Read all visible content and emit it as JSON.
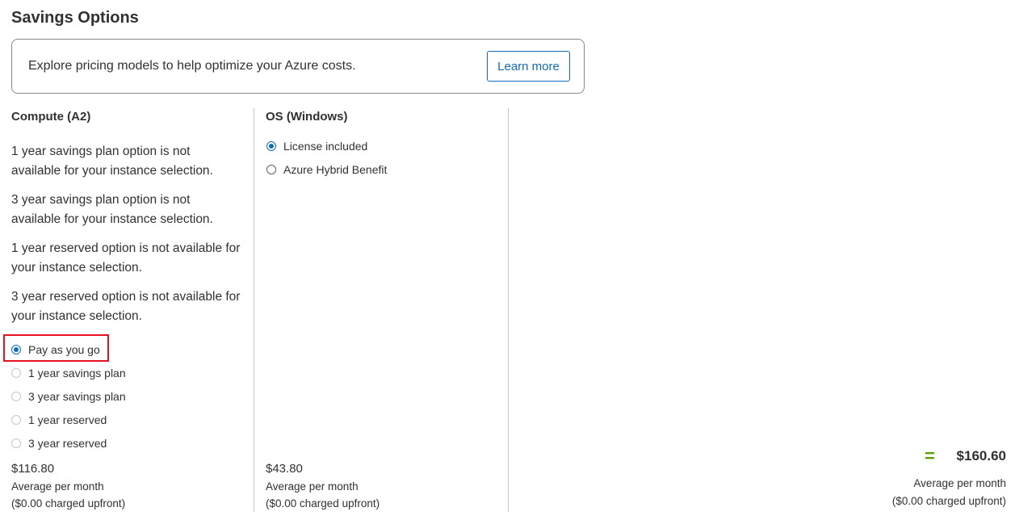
{
  "page": {
    "title": "Savings Options"
  },
  "banner": {
    "text": "Explore pricing models to help optimize your Azure costs.",
    "button_label": "Learn more"
  },
  "compute": {
    "heading": "Compute (A2)",
    "notes": [
      "1 year savings plan option is not available for your instance selection.",
      "3 year savings plan option is not available for your instance selection.",
      "1 year reserved option is not available for your instance selection.",
      "3 year reserved option is not available for your instance selection."
    ],
    "options": [
      {
        "label": "Pay as you go",
        "selected": true,
        "enabled": true
      },
      {
        "label": "1 year savings plan",
        "selected": false,
        "enabled": false
      },
      {
        "label": "3 year savings plan",
        "selected": false,
        "enabled": false
      },
      {
        "label": "1 year reserved",
        "selected": false,
        "enabled": false
      },
      {
        "label": "3 year reserved",
        "selected": false,
        "enabled": false
      }
    ],
    "price": "$116.80",
    "price_caption": "Average per month",
    "upfront": "($0.00 charged upfront)"
  },
  "os": {
    "heading": "OS (Windows)",
    "options": [
      {
        "label": "License included",
        "selected": true,
        "enabled": true
      },
      {
        "label": "Azure Hybrid Benefit",
        "selected": false,
        "enabled": true
      }
    ],
    "price": "$43.80",
    "price_caption": "Average per month",
    "upfront": "($0.00 charged upfront)"
  },
  "summary": {
    "equals_symbol": "=",
    "total": "$160.60",
    "caption": "Average per month",
    "upfront": "($0.00 charged upfront)"
  },
  "colors": {
    "accent": "#0f6cbd",
    "highlight": "#e81123",
    "equals": "#57a300"
  }
}
